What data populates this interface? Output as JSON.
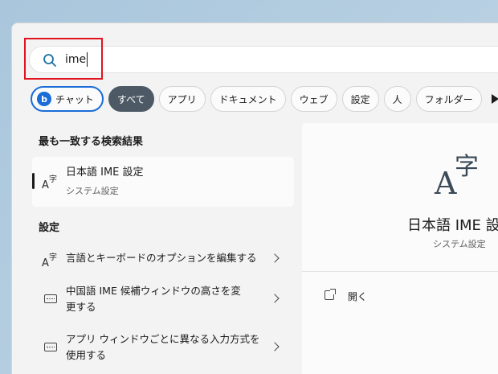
{
  "search": {
    "query": "ime"
  },
  "chips": [
    {
      "label": "チャット",
      "icon": "bing-icon"
    },
    {
      "label": "すべて"
    },
    {
      "label": "アプリ"
    },
    {
      "label": "ドキュメント"
    },
    {
      "label": "ウェブ"
    },
    {
      "label": "設定"
    },
    {
      "label": "人"
    },
    {
      "label": "フォルダー"
    }
  ],
  "best_match": {
    "header": "最も一致する検索結果",
    "title": "日本語 IME 設定",
    "subtitle": "システム設定",
    "icon_glyph": "Aᶠ字"
  },
  "settings_section": {
    "header": "設定",
    "items": [
      {
        "title": "言語とキーボードのオプションを編集する",
        "icon": "language-icon",
        "glyph": "A字"
      },
      {
        "title_line1": "中国語 IME 候補ウィンドウの高さを変",
        "title_line2": "更する",
        "icon": "keyboard-icon"
      },
      {
        "title_line1": "アプリ ウィンドウごとに異なる入力方式を",
        "title_line2": "使用する",
        "icon": "keyboard-icon"
      }
    ]
  },
  "detail": {
    "big_a": "A",
    "big_ji": "字",
    "title": "日本語 IME 設定",
    "subtitle": "システム設定",
    "open_label": "開く"
  },
  "colors": {
    "accent": "#1a6cd8",
    "active_chip": "#4d5a66",
    "highlight": "#e0141e"
  }
}
